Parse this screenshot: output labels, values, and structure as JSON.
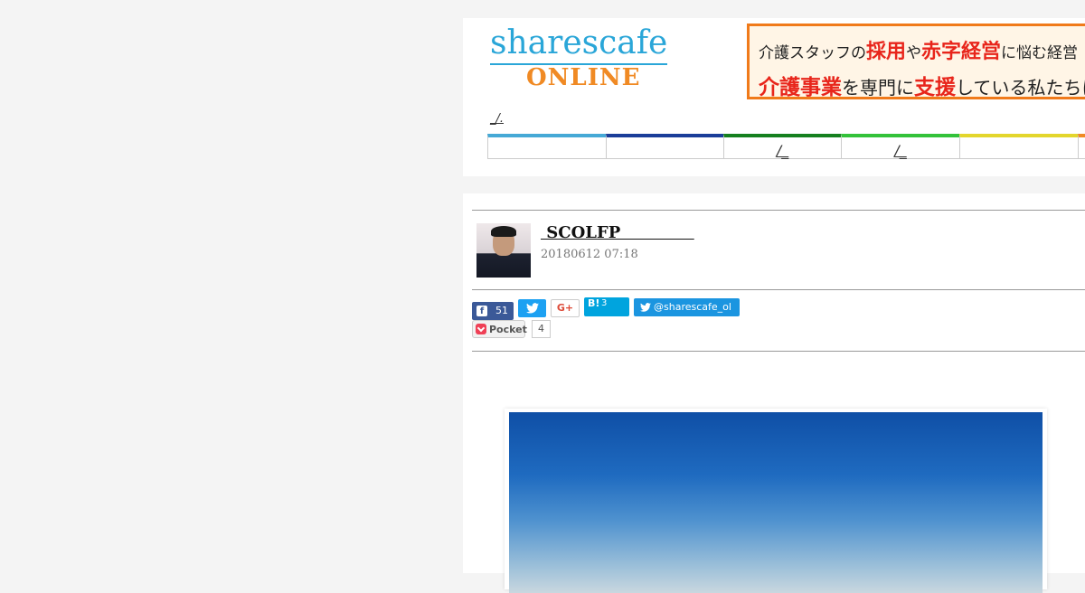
{
  "header": {
    "logo": {
      "top": "sharescafe",
      "bottom": "ONLINE"
    },
    "banner": {
      "line1": [
        {
          "text": "介護スタッフの",
          "highlight": false
        },
        {
          "text": "採用",
          "highlight": true
        },
        {
          "text": "や",
          "highlight": false
        },
        {
          "text": "赤字経営",
          "highlight": true
        },
        {
          "text": "に悩む経営",
          "highlight": false
        }
      ],
      "line2": [
        {
          "text": "介護事業",
          "highlight": true
        },
        {
          "text": "を専門に",
          "highlight": false
        },
        {
          "text": "支援",
          "highlight": true
        },
        {
          "text": "している私たちにご",
          "highlight": false
        }
      ]
    },
    "breadcrumb": "_/.",
    "nav": [
      {
        "label": "",
        "color": "#46a9d6"
      },
      {
        "label": "",
        "color": "#1a3d99"
      },
      {
        "label": "/_",
        "color": "#15801f"
      },
      {
        "label": "/_",
        "color": "#33c23a"
      },
      {
        "label": "",
        "color": "#e3d62c"
      },
      {
        "label": "",
        "color": "#f08a24"
      }
    ]
  },
  "article": {
    "author": " SCOLFP             ",
    "date": "20180612 07:18",
    "share": {
      "facebook_count": "51",
      "facebook_icon": "f",
      "twitter_icon": "🐦",
      "googleplus_label": "G+",
      "hatena_icon": "B!",
      "hatena_count": "3",
      "follow_label": "@sharescafe_ol",
      "pocket_label": "Pocket",
      "pocket_count": "4"
    }
  },
  "colors": {
    "page_bg": "#f4f4f4",
    "logo_blue": "#2aa6d8",
    "logo_orange": "#f08a24",
    "banner_red": "#e8251b",
    "banner_border": "#f07a1a"
  }
}
